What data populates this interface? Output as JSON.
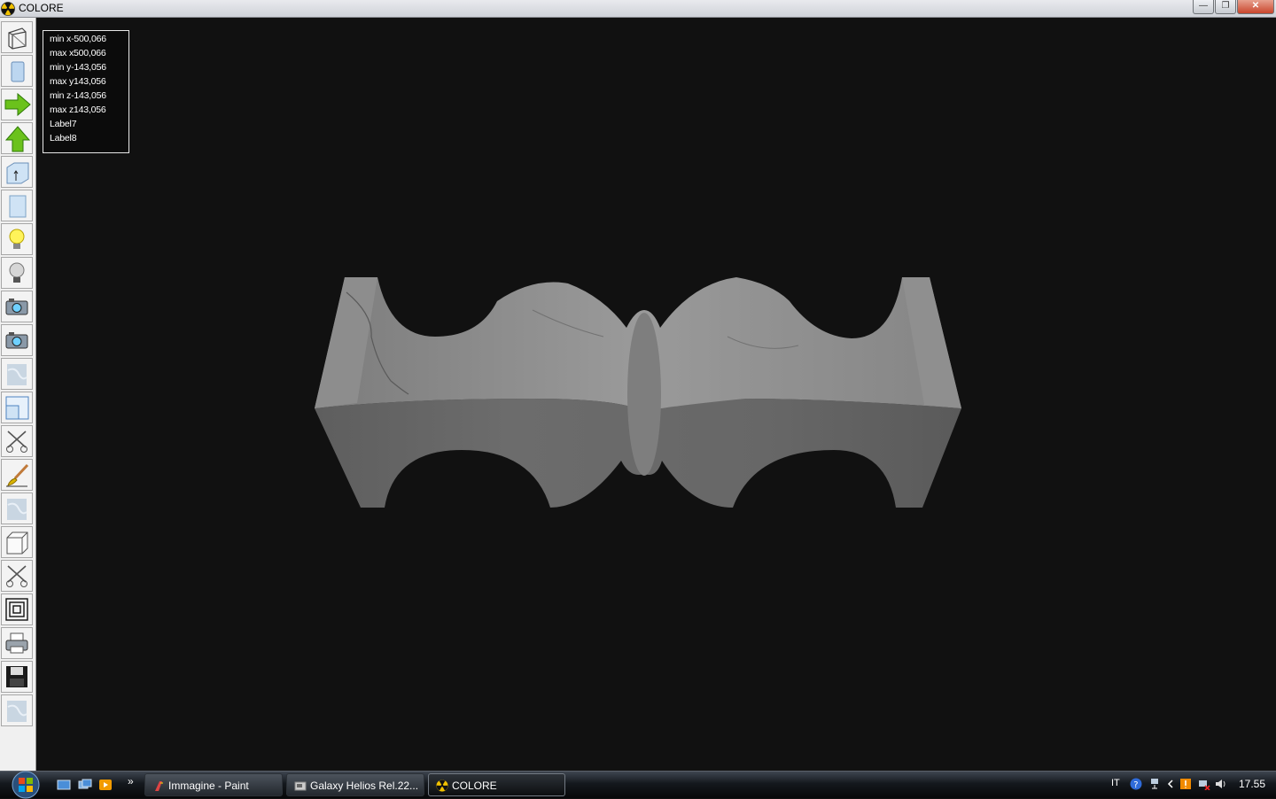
{
  "window": {
    "title": "COLORE",
    "buttons": {
      "minimize": "—",
      "maximize": "❐",
      "close": "✕"
    }
  },
  "toolbar": {
    "tools": [
      {
        "name": "wireframe-icon"
      },
      {
        "name": "solid-view-icon"
      },
      {
        "name": "arrow-right-icon"
      },
      {
        "name": "arrow-up-icon"
      },
      {
        "name": "extrude-icon"
      },
      {
        "name": "surface-view-icon"
      },
      {
        "name": "light-on-icon"
      },
      {
        "name": "light-off-icon"
      },
      {
        "name": "camera-icon"
      },
      {
        "name": "camera-2-icon"
      },
      {
        "name": "texture-icon"
      },
      {
        "name": "window-view-icon"
      },
      {
        "name": "scissors-icon"
      },
      {
        "name": "brush-icon"
      },
      {
        "name": "texture-2-icon"
      },
      {
        "name": "cube-icon"
      },
      {
        "name": "scissors-2-icon"
      },
      {
        "name": "frame-icon"
      },
      {
        "name": "printer-icon"
      },
      {
        "name": "save-icon"
      },
      {
        "name": "texture-3-icon"
      }
    ]
  },
  "info": {
    "lines": [
      "min x-500,066",
      "max x500,066",
      "min y-143,056",
      "max y143,056",
      "min z-143,056",
      "max z143,056",
      "Label7",
      "Label8"
    ]
  },
  "taskbar": {
    "overflow": "»",
    "tasks": [
      {
        "label": "Immagine - Paint"
      },
      {
        "label": "Galaxy Helios  Rel.22..."
      },
      {
        "label": "COLORE"
      }
    ],
    "tray": {
      "lang": "IT",
      "time": "17.55"
    }
  },
  "colors": {
    "background": "#111111",
    "marble": "#8a8a8a",
    "taskbar": "#1a1e23"
  }
}
